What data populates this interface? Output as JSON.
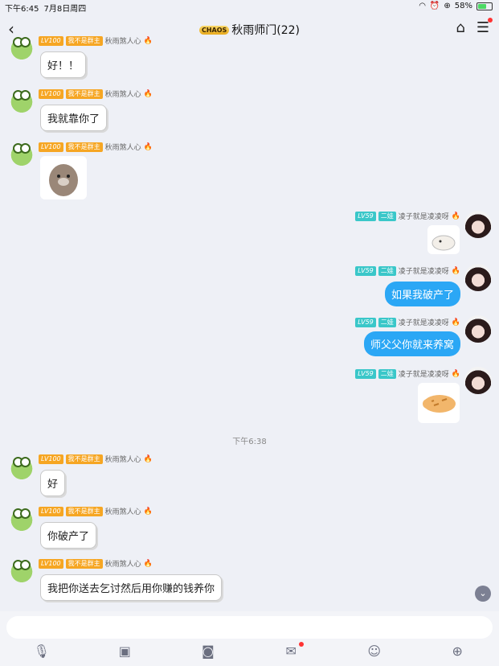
{
  "status": {
    "time": "下午6:45",
    "date": "7月8日周四",
    "battery": "58%",
    "battery_level": 0.58
  },
  "header": {
    "badge": "CHAOS",
    "title": "秋雨师门(22)"
  },
  "messages": {
    "m0": {
      "level": "LV100",
      "title": "我不是群主",
      "name": "秋雨煞人心",
      "text": "好！！"
    },
    "m1": {
      "level": "LV100",
      "title": "我不是群主",
      "name": "秋雨煞人心",
      "text": "我就靠你了"
    },
    "m2": {
      "level": "LV100",
      "title": "我不是群主",
      "name": "秋雨煞人心"
    },
    "m3": {
      "level": "LV59",
      "title": "二娃",
      "name": "凌子就是凌凌呀"
    },
    "m4": {
      "level": "LV59",
      "title": "二娃",
      "name": "凌子就是凌凌呀",
      "text": "如果我破产了"
    },
    "m5": {
      "level": "LV59",
      "title": "二娃",
      "name": "凌子就是凌凌呀",
      "text": "师父父你就来养窝"
    },
    "m6": {
      "level": "LV59",
      "title": "二娃",
      "name": "凌子就是凌凌呀"
    },
    "timestamp": "下午6:38",
    "m7": {
      "level": "LV100",
      "title": "我不是群主",
      "name": "秋雨煞人心",
      "text": "好"
    },
    "m8": {
      "level": "LV100",
      "title": "我不是群主",
      "name": "秋雨煞人心",
      "text": "你破产了"
    },
    "m9": {
      "level": "LV100",
      "title": "我不是群主",
      "name": "秋雨煞人心",
      "text": "我把你送去乞讨然后用你赚的钱养你"
    }
  },
  "toolbar": {
    "icons": [
      "mic-icon",
      "image-icon",
      "camera-icon",
      "redpacket-icon",
      "emoji-icon",
      "plus-icon"
    ]
  }
}
